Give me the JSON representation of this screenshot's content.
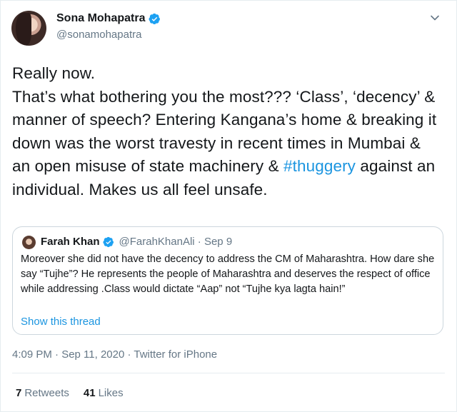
{
  "author": {
    "display_name": "Sona Mohapatra",
    "handle": "@sonamohapatra",
    "verified_icon": "verified-badge-icon"
  },
  "tweet": {
    "text_before_hashtag": "Really now.\nThat’s what bothering you the most??? ‘Class’, ‘decency’ & manner of speech? Entering Kangana’s home & breaking it down was the worst travesty in recent times in Mumbai & an open misuse of state machinery & ",
    "hashtag": "#thuggery",
    "text_after_hashtag": " against an individual. Makes us all feel unsafe."
  },
  "quoted": {
    "display_name": "Farah Khan",
    "handle_date": "@FarahKhanAli · Sep 9",
    "text": "Moreover she did not have the decency to address the CM of Maharashtra. How dare she say “Tujhe”? He represents the people of Maharashtra and deserves the respect of office while addressing .Class would dictate “Aap” not “Tujhe kya lagta hain!”",
    "show_thread": "Show this thread"
  },
  "meta": {
    "timestamp": "4:09 PM · Sep 11, 2020 · Twitter for iPhone"
  },
  "stats": {
    "retweets_count": "7",
    "retweets_label": "Retweets",
    "likes_count": "41",
    "likes_label": "Likes"
  },
  "colors": {
    "accent": "#1b95e0",
    "secondary_text": "#657786",
    "border": "#ccd6dd"
  }
}
